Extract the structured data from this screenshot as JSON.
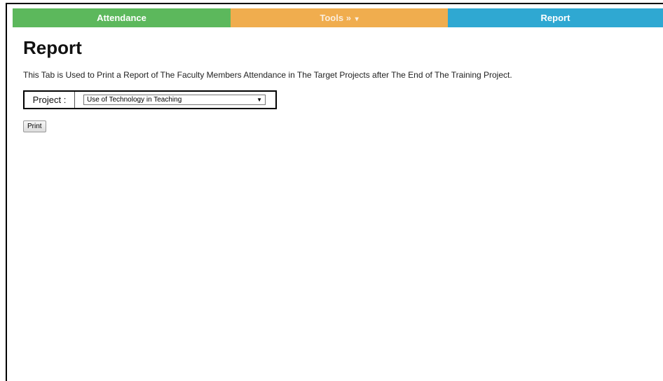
{
  "nav": {
    "tabs": [
      {
        "label": "Attendance",
        "color": "#5cb85c"
      },
      {
        "label": "Tools »",
        "color": "#f0ad4e",
        "caret_icon": "caret-down-icon"
      },
      {
        "label": "Report",
        "color": "#2fa8d2"
      }
    ]
  },
  "main": {
    "title": "Report",
    "description": "This Tab is Used to Print a Report of The Faculty Members Attendance in The Target Projects after The End of The Training Project.",
    "project_label": "Project :",
    "project_selected": "Use of Technology in Teaching",
    "print_label": "Print"
  }
}
